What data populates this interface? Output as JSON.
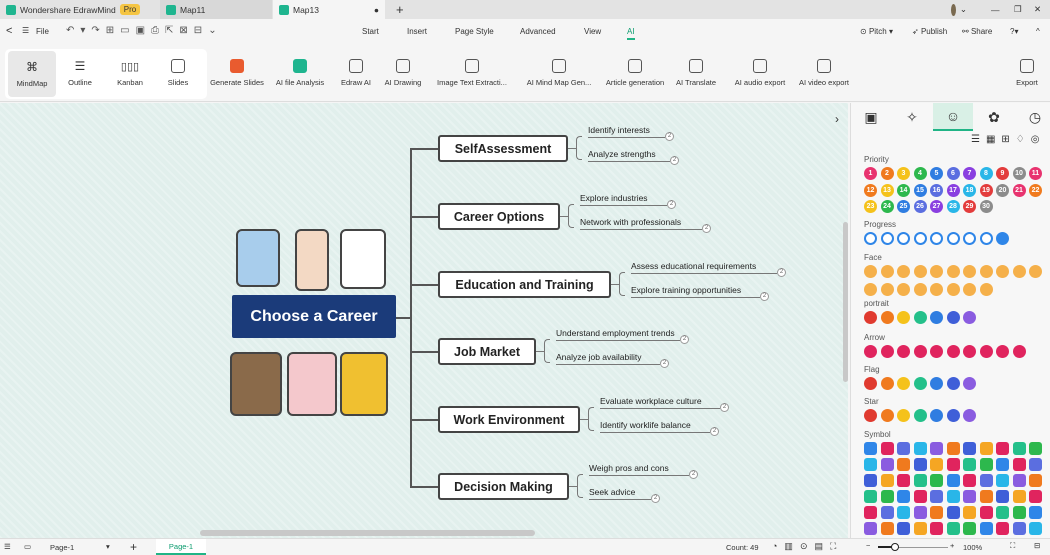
{
  "titlebar": {
    "app_tab": "Wondershare EdrawMind",
    "pro_badge": "Pro",
    "tabs": [
      "Map11",
      "Map13"
    ],
    "new_tab": "+",
    "window_controls": [
      "—",
      "❐",
      "✕"
    ]
  },
  "menubar": {
    "back": "<",
    "menu": "☰",
    "file": "File",
    "menus": [
      "Start",
      "Insert",
      "Page Style",
      "Advanced",
      "View",
      "AI"
    ],
    "active_menu": "AI",
    "right": {
      "pitch": "Pitch ▾",
      "publish": "Publish",
      "share": "Share",
      "help": "?▾",
      "collapse": "^"
    }
  },
  "ribbon": {
    "views": [
      "MindMap",
      "Outline",
      "Kanban",
      "Slides"
    ],
    "tools": [
      "Generate Slides",
      "AI file Analysis",
      "Edraw AI",
      "AI Drawing",
      "Image Text Extracti...",
      "AI Mind Map Gen...",
      "Article generation",
      "AI Translate",
      "AI audio export",
      "AI video export"
    ],
    "export": "Export"
  },
  "mindmap": {
    "central": "Choose a Career",
    "topics": [
      {
        "label": "SelfAssessment",
        "subs": [
          "Identify interests",
          "Analyze strengths"
        ]
      },
      {
        "label": "Career Options",
        "subs": [
          "Explore industries",
          "Network with professionals"
        ]
      },
      {
        "label": "Education and Training",
        "subs": [
          "Assess educational requirements",
          "Explore training opportunities"
        ]
      },
      {
        "label": "Job Market",
        "subs": [
          "Understand employment trends",
          "Analyze job availability"
        ]
      },
      {
        "label": "Work Environment",
        "subs": [
          "Evaluate workplace culture",
          "Identify worklife balance"
        ]
      },
      {
        "label": "Decision Making",
        "subs": [
          "Weigh pros and cons",
          "Seek advice"
        ]
      }
    ],
    "badge": "2"
  },
  "panel": {
    "sections": [
      "Priority",
      "Progress",
      "Face",
      "portrait",
      "Arrow",
      "Flag",
      "Star",
      "Symbol"
    ],
    "priority_colors": [
      "#e8336f",
      "#f07a1e",
      "#f5c21b",
      "#2db84d",
      "#2f7de1",
      "#5b6ee0",
      "#8a3fe0",
      "#29b6e8",
      "#e33c3c",
      "#8c8c8c"
    ],
    "rainbow": [
      "#e03a2f",
      "#f07a1e",
      "#f5c21b",
      "#24c08a",
      "#2f7de1",
      "#3f5fd8",
      "#8a5ce0"
    ]
  },
  "status": {
    "page_select": "Page-1",
    "add_page": "+",
    "page_tab": "Page-1",
    "count": "Count: 49",
    "zoom": "100%"
  }
}
